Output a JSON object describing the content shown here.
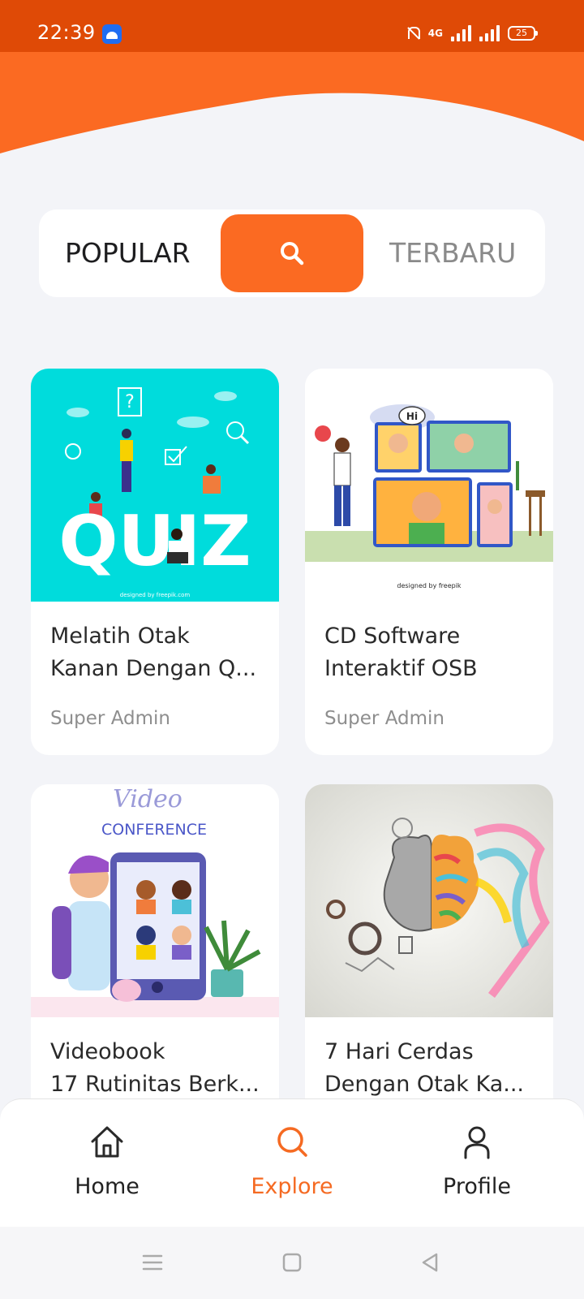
{
  "status_bar": {
    "time": "22:39",
    "app_icon": "android-icon",
    "network_type": "4G",
    "battery_level": "25",
    "icons": [
      "bell-muted-icon",
      "signal-icon",
      "signal-icon",
      "battery-icon"
    ]
  },
  "colors": {
    "accent": "#fb6a22",
    "status_bar": "#df4a06",
    "background": "#f3f4f8"
  },
  "tabs": {
    "popular_label": "POPULAR",
    "search_icon": "search-icon",
    "latest_label": "TERBARU"
  },
  "cards": [
    {
      "title_line1": "Melatih Otak",
      "title_line2": "Kanan Dengan Q...",
      "author": "Super Admin"
    },
    {
      "title_line1": "CD Software",
      "title_line2": "Interaktif OSB",
      "author": "Super Admin"
    },
    {
      "title_line1": "Videobook",
      "title_line2": "17 Rutinitas Berk...",
      "author": ""
    },
    {
      "title_line1": "7 Hari Cerdas",
      "title_line2": "Dengan Otak Ka...",
      "author": ""
    }
  ],
  "thumbnails": {
    "quiz_word": "QUIZ",
    "quiz_credit": "designed by freepik.com",
    "chat_bubble": "Hi",
    "call_credit": "designed by freepik",
    "video_word": "Video",
    "conference_word": "CONFERENCE"
  },
  "bottom_nav": {
    "home_label": "Home",
    "explore_label": "Explore",
    "profile_label": "Profile",
    "active": "Explore"
  }
}
